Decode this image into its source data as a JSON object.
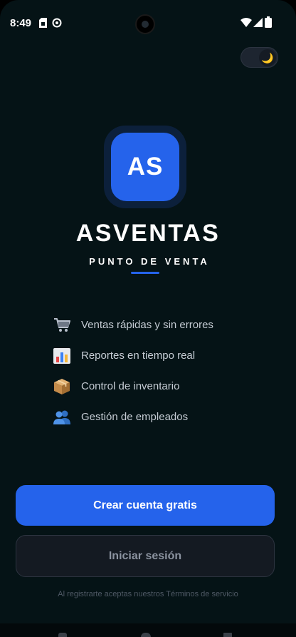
{
  "status_bar": {
    "time": "8:49",
    "icons": [
      "sim-card-icon",
      "sync-icon",
      "wifi-icon",
      "signal-icon",
      "battery-icon"
    ]
  },
  "theme_toggle": {
    "icon": "moon-icon",
    "glyph": "🌙",
    "state": "dark"
  },
  "brand": {
    "logo_text": "AS",
    "name": "ASVENTAS",
    "tagline": "PUNTO DE VENTA",
    "accent_color": "#2563eb"
  },
  "features": [
    {
      "icon": "shopping-cart-icon",
      "glyph": "🛒",
      "label": "Ventas rápidas y sin errores"
    },
    {
      "icon": "bar-chart-icon",
      "glyph": "📊",
      "label": "Reportes en tiempo real"
    },
    {
      "icon": "package-icon",
      "glyph": "📦",
      "label": "Control de inventario"
    },
    {
      "icon": "people-icon",
      "glyph": "👥",
      "label": "Gestión de empleados"
    }
  ],
  "actions": {
    "create_account": "Crear cuenta gratis",
    "login": "Iniciar sesión"
  },
  "terms_text": "Al registrarte aceptas nuestros Términos de servicio",
  "colors": {
    "background": "#051316",
    "primary": "#2563eb",
    "secondary_button": "#141a22"
  }
}
